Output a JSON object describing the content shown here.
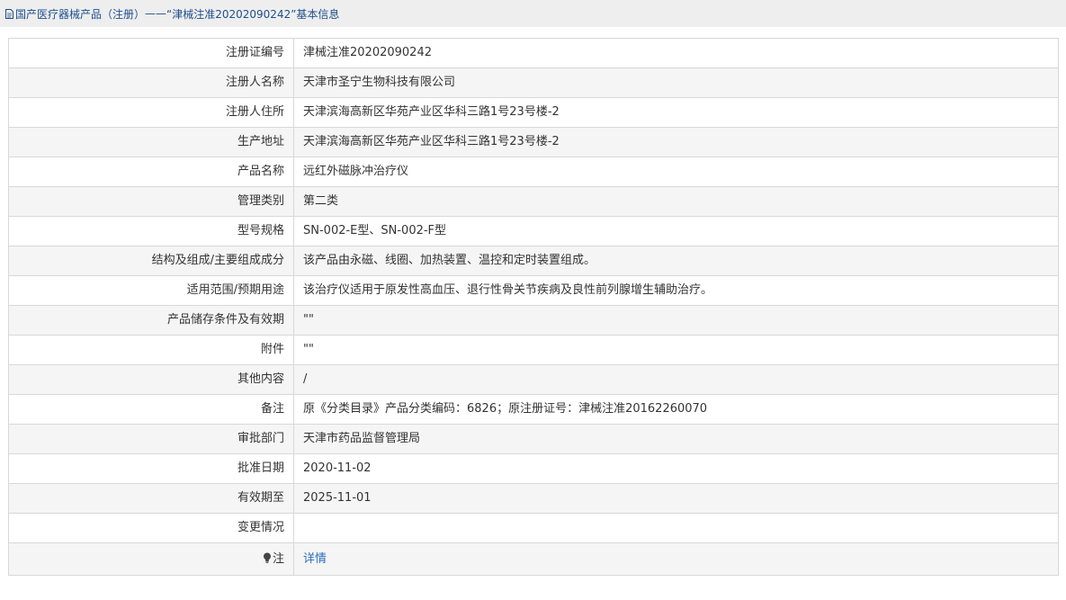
{
  "breadcrumb": {
    "category": "国产医疗器械产品（注册）",
    "separator": " —— ",
    "current": "“津械注准20202090242”基本信息"
  },
  "rows": [
    {
      "label": "注册证编号",
      "value": "津械注准20202090242"
    },
    {
      "label": "注册人名称",
      "value": "天津市圣宁生物科技有限公司"
    },
    {
      "label": "注册人住所",
      "value": "天津滨海高新区华苑产业区华科三路1号23号楼-2"
    },
    {
      "label": "生产地址",
      "value": "天津滨海高新区华苑产业区华科三路1号23号楼-2"
    },
    {
      "label": "产品名称",
      "value": "远红外磁脉冲治疗仪"
    },
    {
      "label": "管理类别",
      "value": "第二类"
    },
    {
      "label": "型号规格",
      "value": "SN-002-E型、SN-002-F型"
    },
    {
      "label": "结构及组成/主要组成成分",
      "value": "该产品由永磁、线圈、加热装置、温控和定时装置组成。"
    },
    {
      "label": "适用范围/预期用途",
      "value": "该治疗仪适用于原发性高血压、退行性骨关节疾病及良性前列腺增生辅助治疗。"
    },
    {
      "label": "产品储存条件及有效期",
      "value": "\"\""
    },
    {
      "label": "附件",
      "value": "\"\""
    },
    {
      "label": "其他内容",
      "value": "/"
    },
    {
      "label": "备注",
      "value": "原《分类目录》产品分类编码：6826；原注册证号：津械注准20162260070"
    },
    {
      "label": "审批部门",
      "value": "天津市药品监督管理局"
    },
    {
      "label": "批准日期",
      "value": "2020-11-02"
    },
    {
      "label": "有效期至",
      "value": "2025-11-01"
    },
    {
      "label": "变更情况",
      "value": ""
    }
  ],
  "note": {
    "label": "注",
    "link": "详情"
  },
  "colors": {
    "link": "#2a6ebd",
    "breadcrumb": "#1e4e8c",
    "border": "#d8d8d8",
    "stripe": "#f5f5f5"
  }
}
